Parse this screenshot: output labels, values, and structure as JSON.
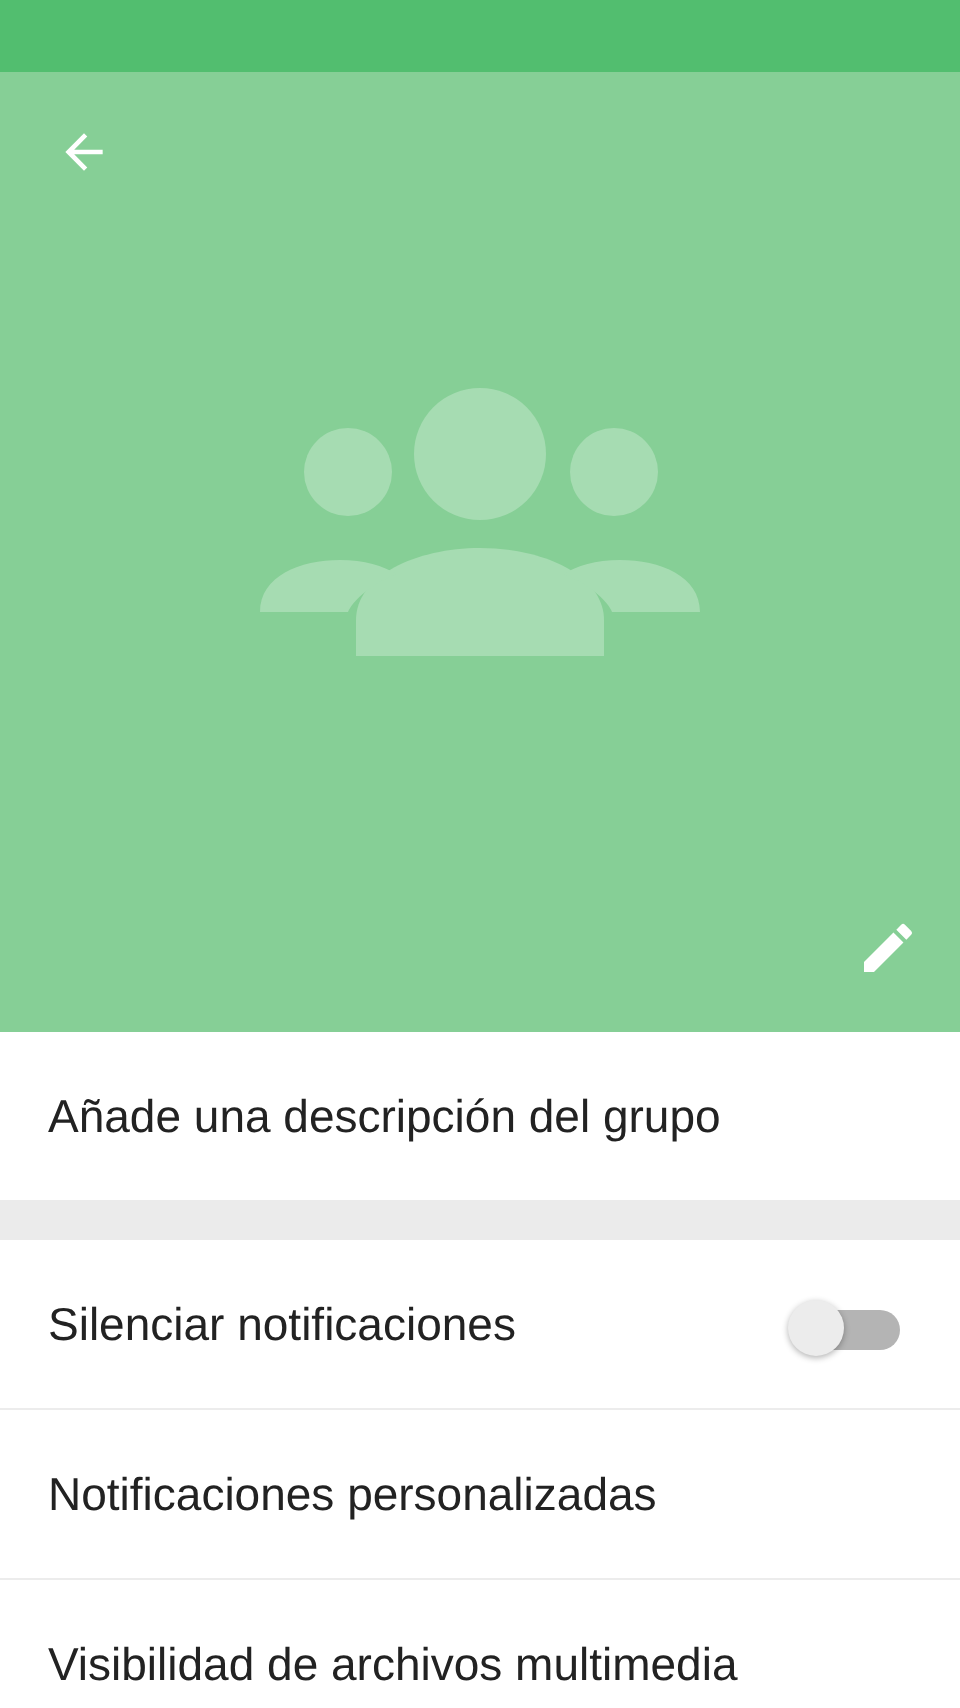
{
  "header": {
    "kind": "group-photo-placeholder"
  },
  "description": {
    "placeholder": "Añade una descripción del grupo"
  },
  "settings": [
    {
      "kind": "toggle",
      "label": "Silenciar notificaciones",
      "on": false
    },
    {
      "kind": "plain",
      "label": "Notificaciones personalizadas"
    },
    {
      "kind": "plain",
      "label": "Visibilidad de archivos multimedia"
    }
  ]
}
